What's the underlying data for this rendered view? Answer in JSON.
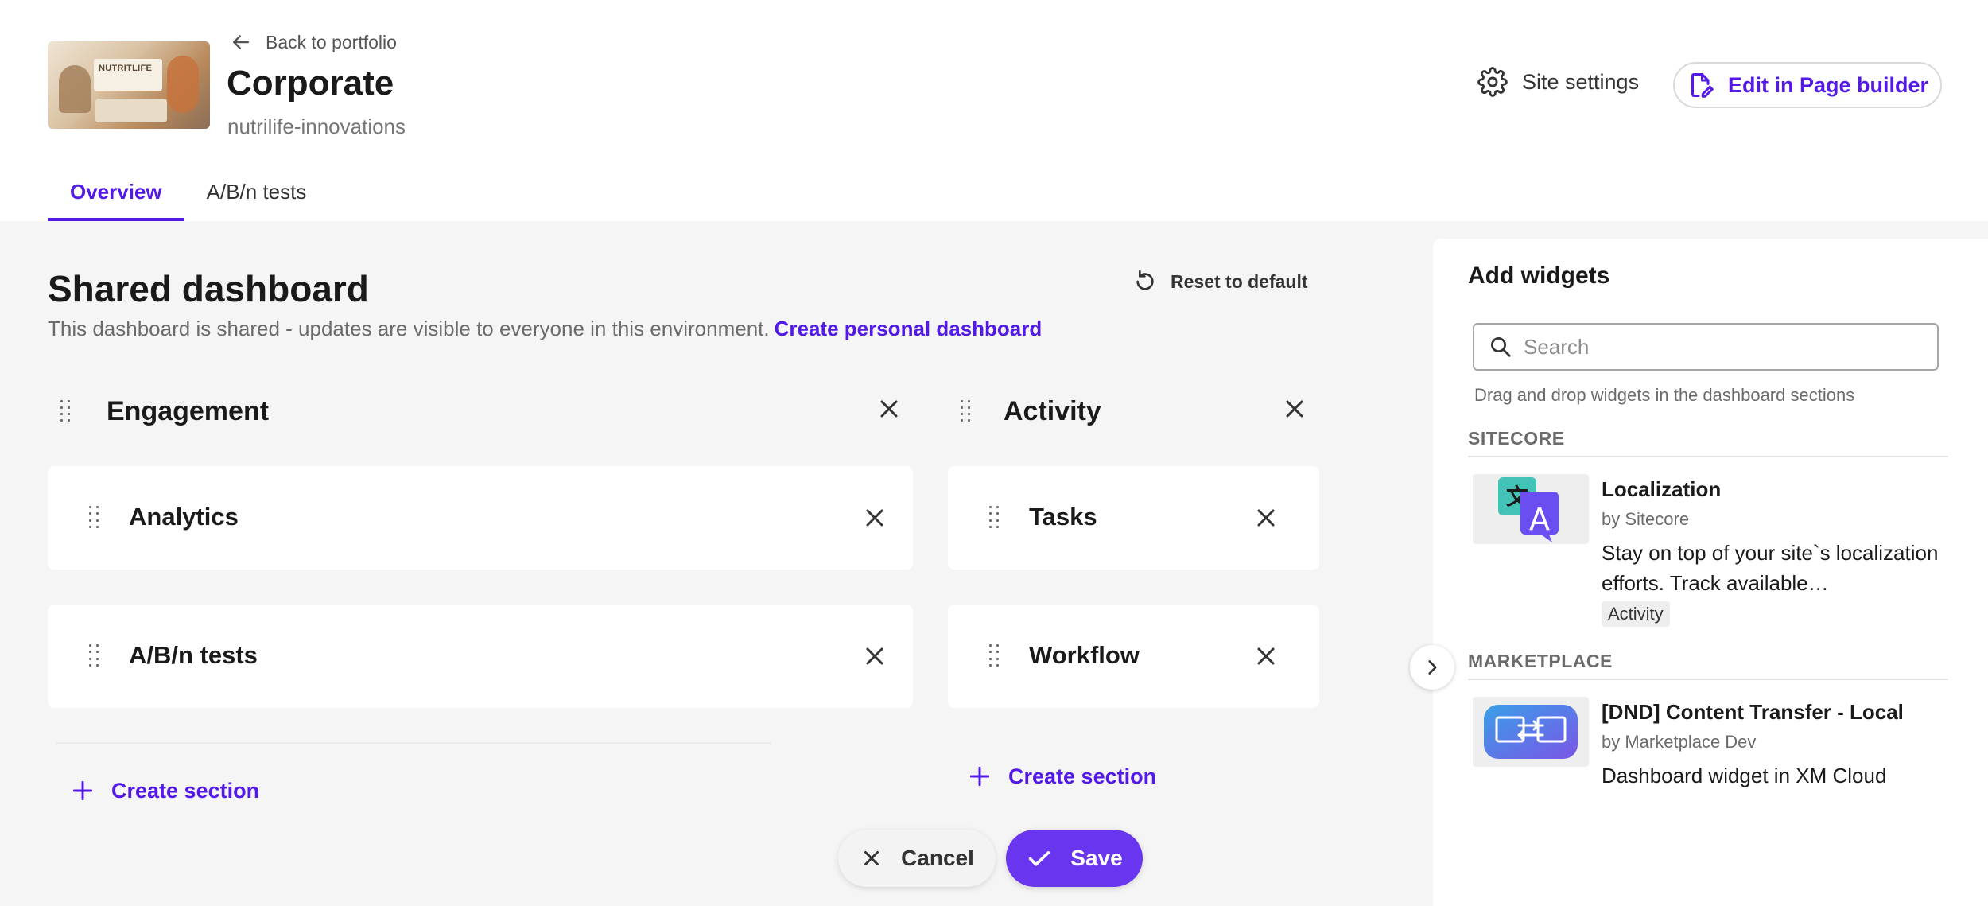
{
  "header": {
    "back_label": "Back to portfolio",
    "title": "Corporate",
    "subtitle": "nutrilife-innovations",
    "thumbnail_text": "NUTRITLIFE",
    "site_settings_label": "Site settings",
    "edit_label": "Edit in Page builder"
  },
  "tabs": [
    {
      "label": "Overview",
      "active": true
    },
    {
      "label": "A/B/n tests",
      "active": false
    }
  ],
  "dashboard": {
    "title": "Shared dashboard",
    "description": "This dashboard is shared - updates are visible to everyone in this environment.",
    "personal_link": "Create personal dashboard",
    "reset_label": "Reset to default",
    "sections": [
      {
        "title": "Engagement",
        "widgets": [
          "Analytics",
          "A/B/n tests"
        ],
        "create_label": "Create section"
      },
      {
        "title": "Activity",
        "widgets": [
          "Tasks",
          "Workflow"
        ],
        "create_label": "Create section"
      }
    ],
    "cancel_label": "Cancel",
    "save_label": "Save"
  },
  "widgets_panel": {
    "title": "Add widgets",
    "search_placeholder": "Search",
    "hint": "Drag and drop widgets in the dashboard sections",
    "categories": [
      {
        "name": "SITECORE",
        "items": [
          {
            "name": "Localization",
            "by": "by Sitecore",
            "description": "Stay on top of your site`s localization efforts. Track available…",
            "tag": "Activity",
            "icon": "translate-icon"
          }
        ]
      },
      {
        "name": "MARKETPLACE",
        "items": [
          {
            "name": "[DND] Content Transfer - Local",
            "by": "by Marketplace Dev",
            "description": "Dashboard widget in XM Cloud",
            "icon": "content-transfer-icon"
          }
        ]
      }
    ]
  },
  "colors": {
    "accent": "#5319e7",
    "save_button": "#6a35ef",
    "main_bg": "#f5f5f5"
  }
}
